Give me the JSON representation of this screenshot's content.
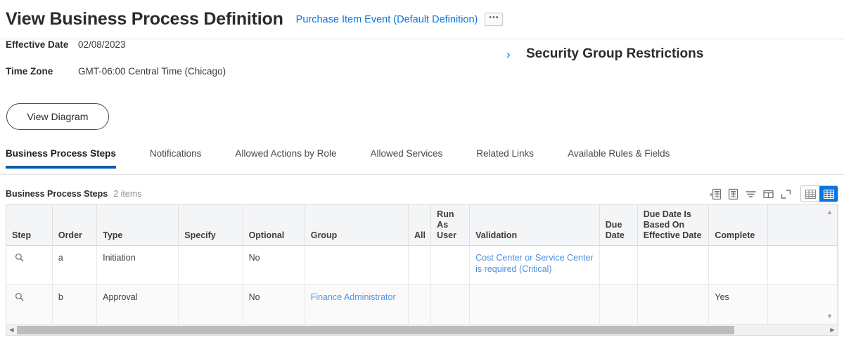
{
  "header": {
    "title": "View Business Process Definition",
    "subject_link": "Purchase Item Event (Default Definition)",
    "related_actions_label": "•••"
  },
  "summary": {
    "fields": [
      {
        "label": "Effective Date",
        "value": "02/08/2023"
      },
      {
        "label": "Time Zone",
        "value": "GMT-06:00 Central Time (Chicago)"
      }
    ],
    "security_group_restrictions": {
      "chevron": "›",
      "title": "Security Group Restrictions"
    },
    "view_diagram_label": "View Diagram"
  },
  "tabs": [
    {
      "label": "Business Process Steps",
      "active": true
    },
    {
      "label": "Notifications",
      "active": false
    },
    {
      "label": "Allowed Actions by Role",
      "active": false
    },
    {
      "label": "Allowed Services",
      "active": false
    },
    {
      "label": "Related Links",
      "active": false
    },
    {
      "label": "Available Rules & Fields",
      "active": false
    }
  ],
  "grid": {
    "caption": "Business Process Steps",
    "count": "2 items",
    "toolbar": [
      {
        "name": "export-to-excel-icon",
        "title": "Export to Excel"
      },
      {
        "name": "view-as-worksheet-icon",
        "title": "View as Worksheet"
      },
      {
        "name": "filter-icon",
        "title": "Filter"
      },
      {
        "name": "toggle-fullscreen-panel-icon",
        "title": "Toggle Panel"
      },
      {
        "name": "expand-icon",
        "title": "Expand"
      }
    ],
    "view_toggle": [
      {
        "name": "grid-view-icon",
        "active": false
      },
      {
        "name": "table-view-icon",
        "active": true
      }
    ],
    "columns": [
      "Step",
      "Order",
      "Type",
      "Specify",
      "Optional",
      "Group",
      "All",
      "Run As User",
      "Validation",
      "Due Date",
      "Due Date Is Based On Effective Date",
      "Complete",
      ""
    ],
    "rows": [
      {
        "step_icon": "magnifier-icon",
        "order": "a",
        "type": "Initiation",
        "specify": "",
        "optional": "No",
        "group": "",
        "group_is_link": false,
        "all": "",
        "run_as_user": "",
        "validation": "Cost Center or Service Center is required (Critical)",
        "validation_is_link": true,
        "due_date": "",
        "due_date_based_on_effective_date": "",
        "complete": ""
      },
      {
        "step_icon": "magnifier-icon",
        "order": "b",
        "type": "Approval",
        "specify": "",
        "optional": "No",
        "group": "Finance Administrator",
        "group_is_link": true,
        "all": "",
        "run_as_user": "",
        "validation": "",
        "validation_is_link": false,
        "due_date": "",
        "due_date_based_on_effective_date": "",
        "complete": "Yes"
      }
    ],
    "vertical_scroll": {
      "up": "▲",
      "down": "▼"
    },
    "horizontal_scroll": {
      "left": "◀",
      "right": "▶"
    }
  },
  "colors": {
    "link": "#0875e1",
    "tab_underline": "#0b5cab",
    "active_toggle": "#0875e1",
    "header_bg": "#f4f5f7"
  }
}
